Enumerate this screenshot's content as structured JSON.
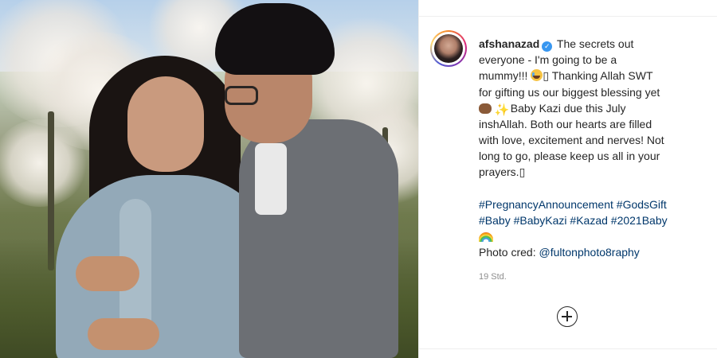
{
  "post": {
    "username": "afshanazad",
    "verified_icon": "verified-badge-icon",
    "caption_lines": [
      "The secrets out",
      "everyone - I'm going to be a",
      "mummy!!! ",
      " Thanking Allah SWT",
      "for gifting us our biggest blessing yet",
      "Baby Kazi due this July",
      "inshAllah. Both our hearts are filled",
      "with love, excitement and nerves! Not",
      "long to go, please keep us all in your",
      "prayers."
    ],
    "missing_glyph": "▯",
    "hashtags_line1": "#PregnancyAnnouncement #GodsGift",
    "hashtags_line2": "#Baby #BabyKazi #Kazad #2021Baby",
    "photo_cred_label": "Photo cred: ",
    "photo_cred_handle": "@fultonphoto8raphy",
    "timestamp": "19 Std."
  },
  "icons": {
    "avatar": "profile-avatar",
    "crying_face": "crying-face-emoji",
    "hands": "raised-hands-emoji",
    "sparkles": "sparkles-emoji",
    "rainbow": "rainbow-emoji",
    "load_more": "plus-circle-icon"
  },
  "colors": {
    "hashtag": "#00376b",
    "verified": "#3897f0",
    "muted": "#8e8e8e",
    "text": "#262626"
  }
}
